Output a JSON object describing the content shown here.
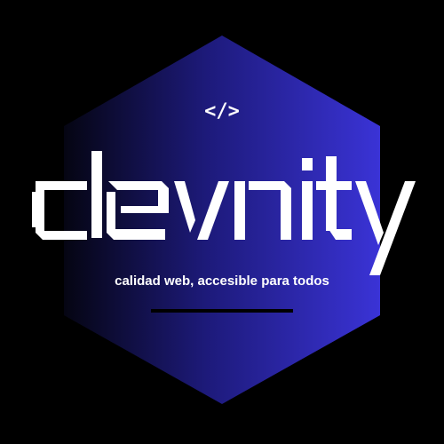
{
  "brand": {
    "code_symbol": "</>",
    "name": "devnity",
    "tagline": "calidad web, accesible para todos"
  },
  "colors": {
    "background": "#000000",
    "hexagon_gradient_start": "#050512",
    "hexagon_gradient_end": "#3a33d6",
    "text": "#ffffff",
    "underline": "#000000"
  }
}
